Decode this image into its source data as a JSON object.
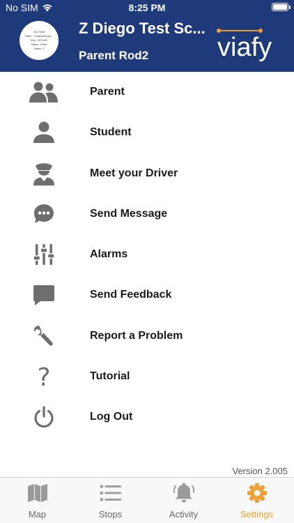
{
  "status_bar": {
    "carrier": "No SIM",
    "time": "8:25 PM"
  },
  "header": {
    "school_name": "Z Diego Test Sc...",
    "parent_name": "Parent Rod2",
    "brand": "viafy",
    "avatar_lines": [
      "Sun. 0948",
      "Driver : ConstuctionLew...",
      "IPad : 0371093",
      "Status : Online",
      "Speed : 0"
    ]
  },
  "menu": {
    "items": [
      {
        "label": "Parent",
        "icon": "parents-icon"
      },
      {
        "label": "Student",
        "icon": "person-icon"
      },
      {
        "label": "Meet your Driver",
        "icon": "driver-icon"
      },
      {
        "label": "Send Message",
        "icon": "chat-bubble-icon"
      },
      {
        "label": "Alarms",
        "icon": "sliders-icon"
      },
      {
        "label": "Send Feedback",
        "icon": "feedback-icon"
      },
      {
        "label": "Report a Problem",
        "icon": "wrench-icon"
      },
      {
        "label": "Tutorial",
        "icon": "question-icon"
      },
      {
        "label": "Log Out",
        "icon": "power-icon"
      }
    ]
  },
  "version": "Version 2.005",
  "tabbar": {
    "tabs": [
      {
        "label": "Map",
        "icon": "map-icon"
      },
      {
        "label": "Stops",
        "icon": "list-icon"
      },
      {
        "label": "Activity",
        "icon": "bell-icon"
      },
      {
        "label": "Settings",
        "icon": "gear-icon",
        "active": true
      }
    ]
  },
  "colors": {
    "header_bg": "#1f3a7a",
    "accent": "#f0a030",
    "icon_gray": "#6e6e6e"
  }
}
